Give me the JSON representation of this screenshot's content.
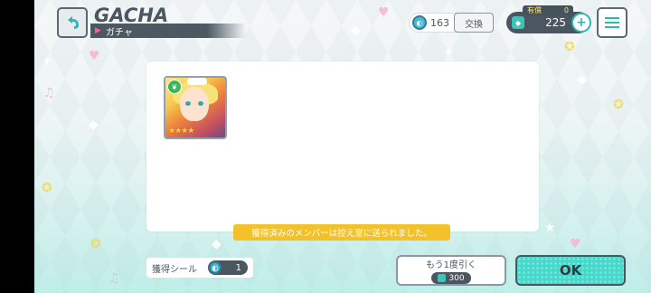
{
  "header": {
    "title": "GACHA",
    "subtitle": "ガチャ"
  },
  "currency": {
    "shard_count": "163",
    "exchange_label": "交換",
    "paid_label": "有償",
    "paid_count": "0",
    "gem_count": "225"
  },
  "result": {
    "card_rarity_stars": 4,
    "card_attribute_icon": "leaf-icon",
    "notice": "獲得済みのメンバーは控え室に送られました。"
  },
  "footer": {
    "seal_label": "獲得シール",
    "seal_count": "1",
    "draw_again_label": "もう1度引く",
    "draw_again_cost": "300",
    "ok_label": "OK"
  },
  "colors": {
    "accent": "#45d9cc",
    "dark": "#4b5660",
    "notice": "#f3c22b"
  }
}
